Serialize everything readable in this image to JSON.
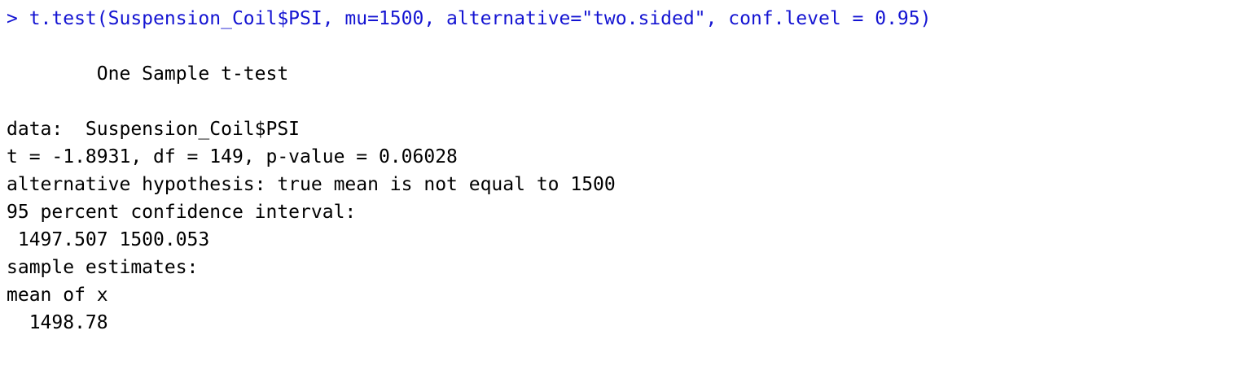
{
  "console": {
    "command": "> t.test(Suspension_Coil$PSI, mu=1500, alternative=\"two.sided\", conf.level = 0.95)",
    "output": {
      "title": "        One Sample t-test",
      "data_line": "data:  Suspension_Coil$PSI",
      "stats_line": "t = -1.8931, df = 149, p-value = 0.06028",
      "alt_hypothesis": "alternative hypothesis: true mean is not equal to 1500",
      "ci_label": "95 percent confidence interval:",
      "ci_values": " 1497.507 1500.053",
      "estimates_label": "sample estimates:",
      "estimate_name": "mean of x",
      "estimate_value": "  1498.78"
    },
    "colors": {
      "command": "#1414d2",
      "output": "#000000",
      "background": "#ffffff"
    }
  }
}
